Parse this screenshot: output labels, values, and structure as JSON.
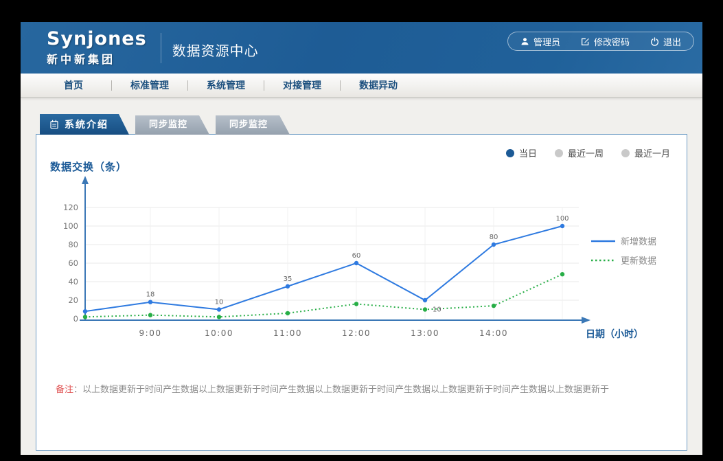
{
  "header": {
    "logo_en": "Synjones",
    "logo_cn": "新中新集团",
    "app_title": "数据资源中心",
    "user_menu": [
      {
        "icon": "user-icon",
        "label": "管理员"
      },
      {
        "icon": "edit-icon",
        "label": "修改密码"
      },
      {
        "icon": "power-icon",
        "label": "退出"
      }
    ]
  },
  "nav": {
    "items": [
      {
        "label": "首页"
      },
      {
        "label": "标准管理"
      },
      {
        "label": "系统管理"
      },
      {
        "label": "对接管理"
      },
      {
        "label": "数据异动"
      }
    ]
  },
  "tabs": [
    {
      "label": "系统介绍",
      "active": true,
      "icon": "clipboard-icon"
    },
    {
      "label": "同步监控",
      "active": false
    },
    {
      "label": "同步监控",
      "active": false
    }
  ],
  "filters": {
    "options": [
      {
        "label": "当日",
        "selected": true
      },
      {
        "label": "最近一周",
        "selected": false
      },
      {
        "label": "最近一月",
        "selected": false
      }
    ]
  },
  "chart_data": {
    "type": "line",
    "title": "数据交换（条）",
    "xlabel": "日期（小时）",
    "ylabel": "",
    "x_ticks": [
      "9:00",
      "10:00",
      "11:00",
      "12:00",
      "13:00",
      "14:00"
    ],
    "y_ticks": [
      0,
      20,
      40,
      60,
      80,
      100,
      120
    ],
    "ylim": [
      0,
      130
    ],
    "grid": true,
    "legend_position": "right",
    "series": [
      {
        "name": "新增数据",
        "color": "#2e7ae0",
        "line_style": "solid",
        "values": [
          8,
          18,
          10,
          35,
          60,
          20,
          80,
          100
        ],
        "point_labels": [
          "",
          "18",
          "10",
          "35",
          "60",
          "",
          "80",
          "100"
        ]
      },
      {
        "name": "更新数据",
        "color": "#27ae46",
        "line_style": "dotted",
        "values": [
          2,
          4,
          2,
          6,
          16,
          10,
          14,
          48
        ],
        "point_labels": [
          "",
          "",
          "",
          "",
          "",
          "10",
          "",
          ""
        ]
      }
    ]
  },
  "note": {
    "label": "备注",
    "text": "：以上数据更新于时间产生数据以上数据更新于时间产生数据以上数据更新于时间产生数据以上数据更新于时间产生数据以上数据更新于"
  },
  "colors": {
    "header_blue": "#1e5c95",
    "accent_blue": "#1b5a97",
    "axis_blue": "#3b78b6",
    "nav_text": "#1b4f7e",
    "inactive_tab": "#9aa6b2",
    "note_red": "#e05252",
    "tick_gray": "#777777"
  }
}
